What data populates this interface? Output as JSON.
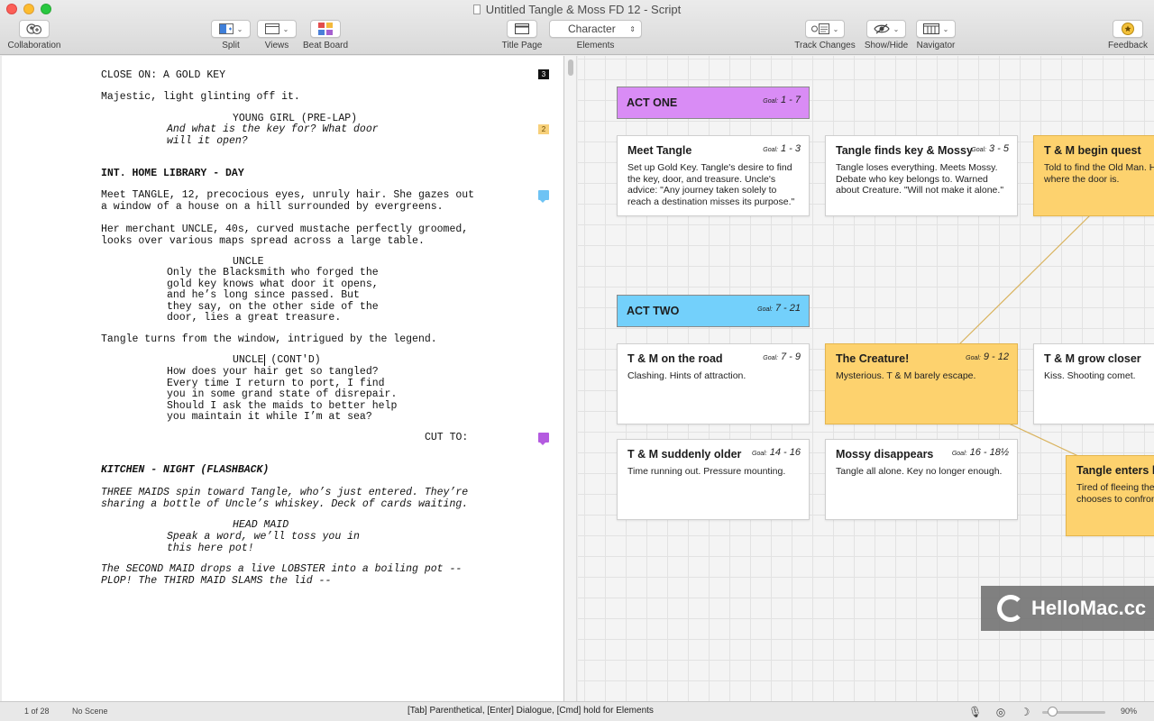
{
  "window": {
    "title": "Untitled Tangle & Moss FD 12 - Script"
  },
  "toolbar": {
    "collaboration": "Collaboration",
    "split": "Split",
    "views": "Views",
    "beat_board": "Beat Board",
    "title_page": "Title Page",
    "elements_value": "Character",
    "elements": "Elements",
    "track_changes": "Track Changes",
    "show_hide": "Show/Hide",
    "navigator": "Navigator",
    "feedback": "Feedback"
  },
  "script": {
    "l1": "CLOSE ON: A GOLD KEY",
    "l2": "Majestic, light glinting off it.",
    "l3": "YOUNG GIRL (PRE-LAP)",
    "l4": "And what is the key for? What door\nwill it open?",
    "l5": "INT. HOME LIBRARY - DAY",
    "l6": "Meet TANGLE, 12, precocious eyes, unruly hair. She gazes out\na window of a house on a hill surrounded by evergreens.",
    "l7": "Her merchant UNCLE, 40s, curved mustache perfectly groomed,\nlooks over various maps spread across a large table.",
    "l8": "UNCLE",
    "l9": "Only the Blacksmith who forged the\ngold key knows what door it opens,\nand he’s long since passed. But\nthey say, on the other side of the\ndoor, lies a great treasure.",
    "l10": "Tangle turns from the window, intrigued by the legend.",
    "l11a": "UNCLE",
    "l11b": " (CONT'D)",
    "l12": "How does your hair get so tangled?\nEvery time I return to port, I find\nyou in some grand state of disrepair.\nShould I ask the maids to better help\nyou maintain it while I’m at sea?",
    "l13": "CUT TO:",
    "l14": "KITCHEN - NIGHT (FLASHBACK)",
    "l15": "THREE MAIDS spin toward Tangle, who’s just entered. They’re\nsharing a bottle of Uncle’s whiskey. Deck of cards waiting.",
    "l16": "HEAD MAID",
    "l17": "Speak a word, we’ll toss you in\nthis here pot!",
    "l18": "The SECOND MAID drops a live LOBSTER into a boiling pot --\nPLOP! The THIRD MAID SLAMS the lid --",
    "markers": {
      "m1": "3",
      "m2": "2"
    }
  },
  "beat_board": {
    "goal_label": "Goal:",
    "act_one": {
      "title": "ACT ONE",
      "goal": "1 - 7",
      "color": "#d98cf5"
    },
    "act_two": {
      "title": "ACT TWO",
      "goal": "7 - 21",
      "color": "#73d0fb"
    },
    "cards": [
      {
        "title": "Meet Tangle",
        "goal": "1 - 3",
        "body": "Set up Gold Key. Tangle's desire to find the key, door, and treasure. Uncle's advice: \"Any journey taken solely to reach a destination misses its purpose.\""
      },
      {
        "title": "Tangle finds key & Mossy",
        "goal": "3 - 5",
        "body": "Tangle loses everything. Meets Mossy. Debate who key belongs to. Warned about Creature. \"Will not make it alone.\""
      },
      {
        "title": "T & M begin quest",
        "goal": "",
        "body": "Told to find the Old Man. He knows where the door is."
      },
      {
        "title": "T & M on the road",
        "goal": "7 - 9",
        "body": "Clashing. Hints of attraction."
      },
      {
        "title": "The Creature!",
        "goal": "9 - 12",
        "body": "Mysterious. T & M barely escape."
      },
      {
        "title": "T & M grow closer",
        "goal": "",
        "body": "Kiss. Shooting comet."
      },
      {
        "title": "T & M suddenly older",
        "goal": "14 - 16",
        "body": "Time running out. Pressure mounting."
      },
      {
        "title": "Mossy disappears",
        "goal": "16 - 18½",
        "body": "Tangle all alone. Key no longer enough."
      },
      {
        "title": "Tangle enters lair",
        "goal": "",
        "body": "Tired of fleeing the Creature, Tangle chooses to confront it."
      }
    ]
  },
  "watermark": "HelloMac.cc",
  "status": {
    "page": "1 of 28",
    "scene": "No Scene",
    "hint": "[Tab]  Parenthetical,  [Enter] Dialogue, [Cmd] hold for Elements",
    "zoom": "90%"
  }
}
